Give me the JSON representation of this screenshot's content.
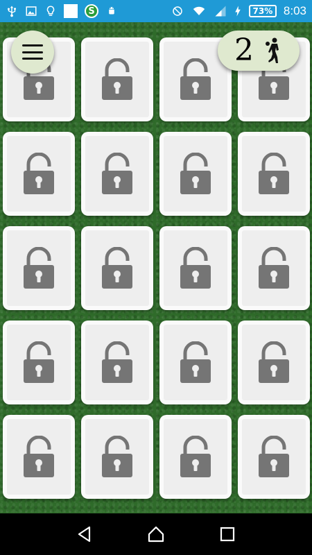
{
  "status_bar": {
    "left_icons": [
      "usb-icon",
      "image-icon",
      "lightbulb-icon",
      "white-square-icon",
      "s-badge-icon",
      "android-icon"
    ],
    "s_badge_letter": "S",
    "right_icons": [
      "do-not-disturb-icon",
      "wifi-icon",
      "signal-icon",
      "battery-icon"
    ],
    "battery": "73%",
    "time": "8:03",
    "color": "#1f9ad6"
  },
  "game": {
    "score": "2",
    "rows": 5,
    "columns": 4,
    "card_state": "locked",
    "background_color": "#2f6b2a",
    "pill_color": "#dfe9cf",
    "lock_color": "#757575"
  },
  "nav_bar": {
    "buttons": [
      "back-icon",
      "home-icon",
      "recents-icon"
    ]
  }
}
